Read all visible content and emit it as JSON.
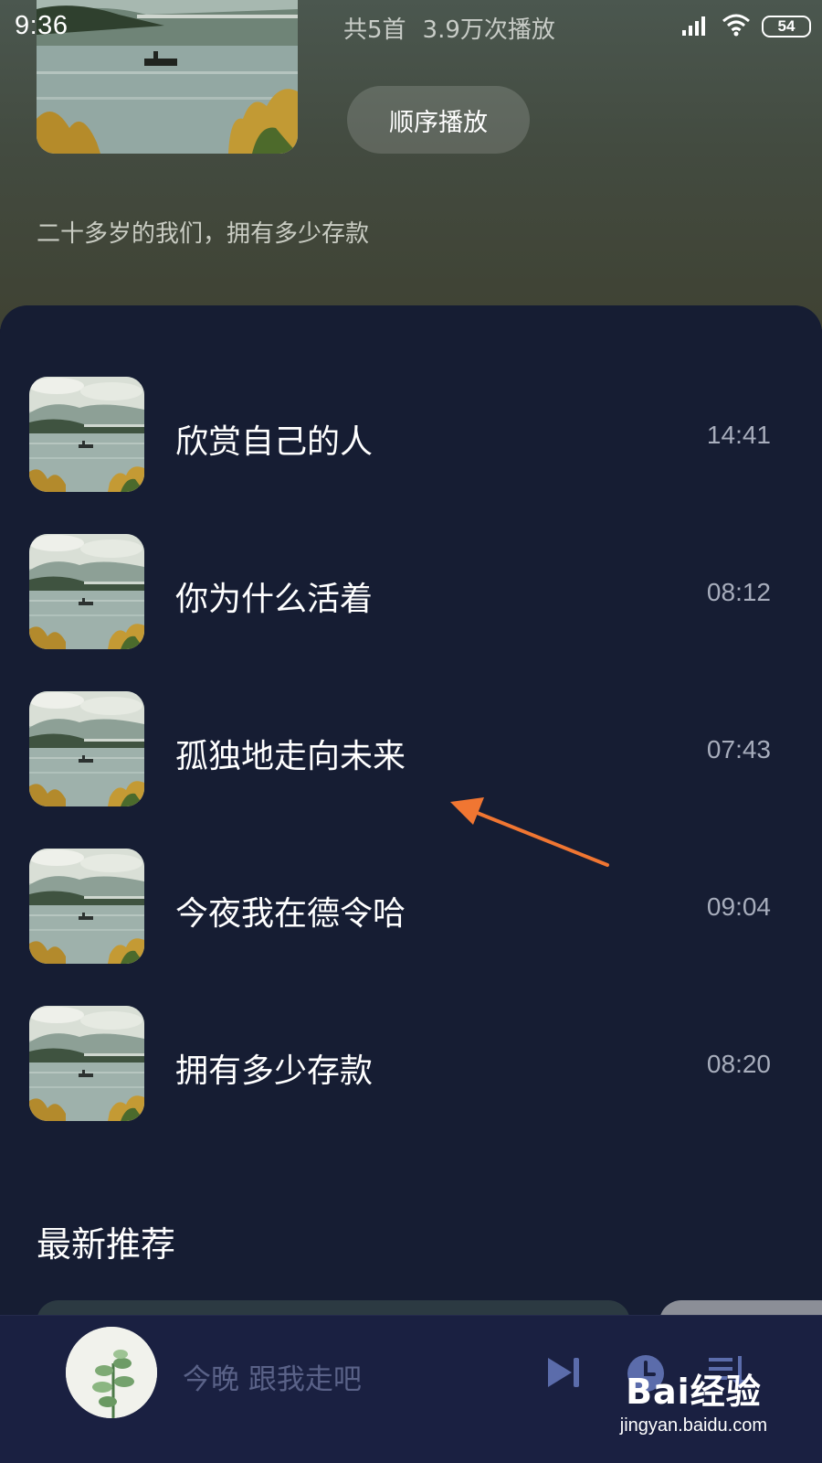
{
  "status_bar": {
    "time": "9:36",
    "battery": "54"
  },
  "header": {
    "stats_count": "共5首",
    "stats_plays": "3.9万次播放",
    "play_order_label": "顺序播放",
    "description": "二十多岁的我们，拥有多少存款"
  },
  "tracks": [
    {
      "title": "欣赏自己的人",
      "duration": "14:41"
    },
    {
      "title": "你为什么活着",
      "duration": "08:12"
    },
    {
      "title": "孤独地走向未来",
      "duration": "07:43"
    },
    {
      "title": "今夜我在德令哈",
      "duration": "09:04"
    },
    {
      "title": "拥有多少存款",
      "duration": "08:20"
    }
  ],
  "section": {
    "recommend_title": "最新推荐"
  },
  "player": {
    "now_playing": "今晚 跟我走吧"
  },
  "watermark": {
    "brand": "Bai经验",
    "url": "jingyan.baidu.com"
  },
  "colors": {
    "panel_bg": "#161d33",
    "player_bg": "#1a2041",
    "annotation_arrow": "#f07632"
  },
  "icons": [
    "signal-icon",
    "wifi-icon",
    "battery-icon",
    "next-track-icon",
    "timer-icon",
    "playlist-icon"
  ]
}
